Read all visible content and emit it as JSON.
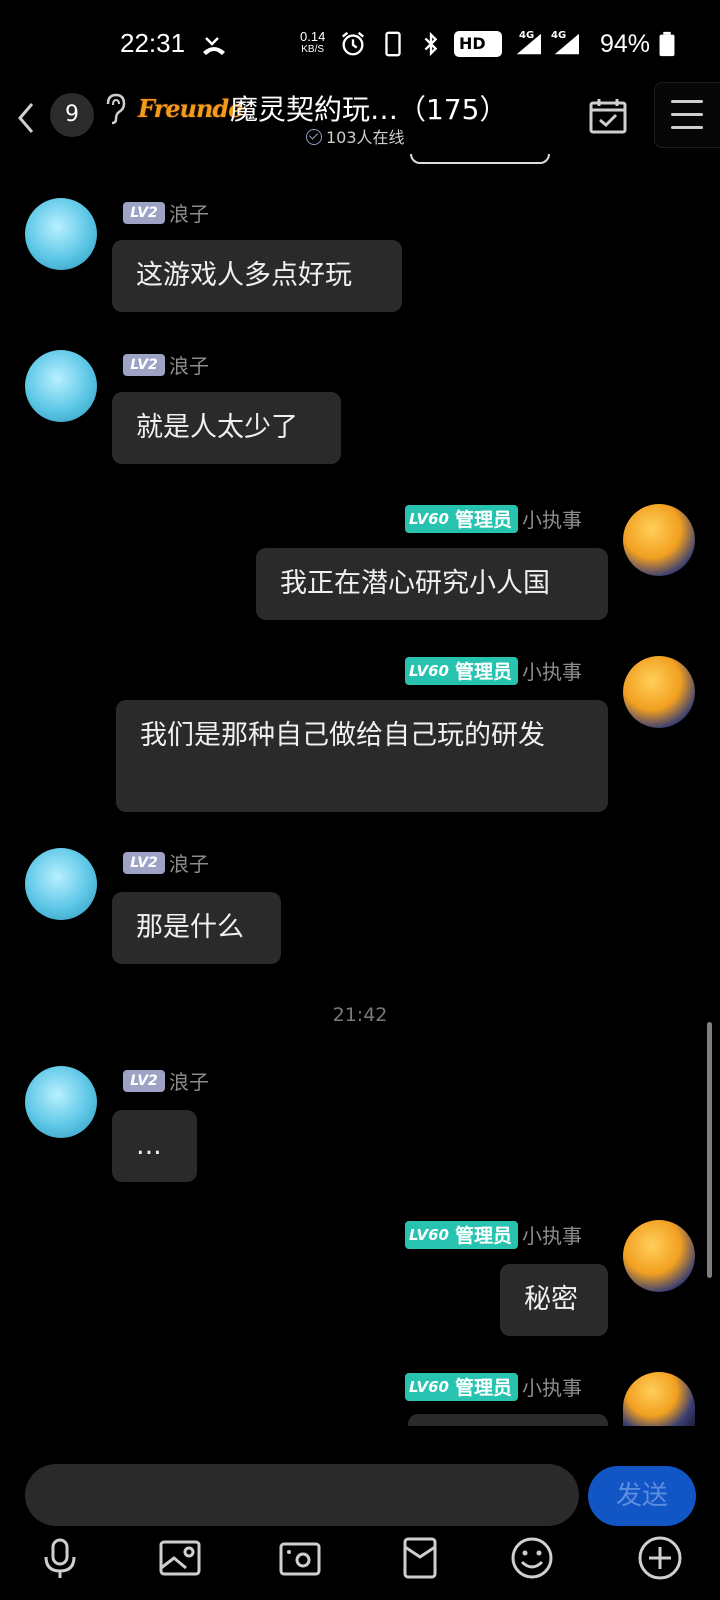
{
  "status_bar": {
    "time": "22:31",
    "net_speed_value": "0.14",
    "net_speed_unit": "KB/S",
    "signal_1": "4G",
    "signal_2": "4G",
    "hd_label": "HD",
    "battery_percent": "94%",
    "icons": [
      "missed-call-icon",
      "alarm-icon",
      "phone-icon",
      "bluetooth-icon",
      "hd-icon",
      "signal-icon",
      "signal-icon",
      "battery-icon"
    ]
  },
  "header": {
    "unread_count": "9",
    "logo_text": "Freunde",
    "title": "魔灵契約玩…（175）",
    "online_text": "103人在线",
    "accent": "#27c3b0"
  },
  "messages": [
    {
      "side": "left",
      "level": "LV2",
      "sender": "浪子",
      "text": "这游戏人多点好玩"
    },
    {
      "side": "left",
      "level": "LV2",
      "sender": "浪子",
      "text": "就是人太少了"
    },
    {
      "side": "right",
      "level": "LV60",
      "role": "管理员",
      "sender": "小执事",
      "text": "我正在潜心研究小人国"
    },
    {
      "side": "right",
      "level": "LV60",
      "role": "管理员",
      "sender": "小执事",
      "text": "我们是那种自己做给自己玩的研发"
    },
    {
      "side": "left",
      "level": "LV2",
      "sender": "浪子",
      "text": "那是什么"
    },
    {
      "side": "left",
      "level": "LV2",
      "sender": "浪子",
      "text": "..."
    },
    {
      "side": "right",
      "level": "LV60",
      "role": "管理员",
      "sender": "小执事",
      "text": "秘密"
    },
    {
      "side": "right",
      "level": "LV60",
      "role": "管理员",
      "sender": "小执事",
      "text": ""
    }
  ],
  "time_separator": "21:42",
  "input": {
    "placeholder": "",
    "value": "",
    "send_label": "发送"
  },
  "toolbar": [
    "microphone-icon",
    "image-icon",
    "camera-icon",
    "red-packet-icon",
    "emoji-icon",
    "plus-icon"
  ]
}
